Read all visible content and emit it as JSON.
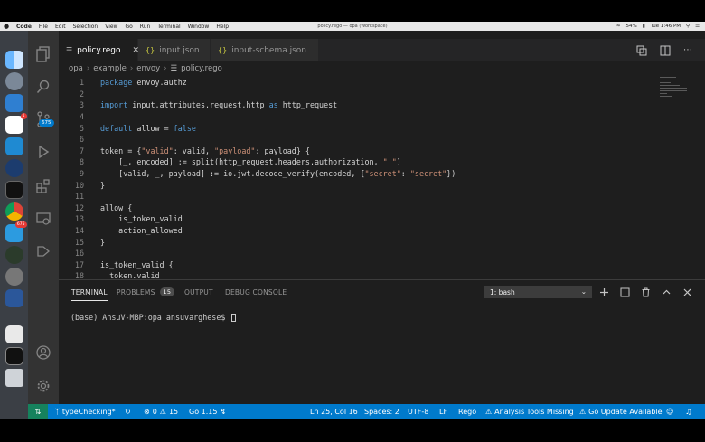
{
  "menubar": {
    "apple": "",
    "items": [
      "Code",
      "File",
      "Edit",
      "Selection",
      "View",
      "Go",
      "Run",
      "Terminal",
      "Window",
      "Help"
    ],
    "window_title": "policy.rego — opa (Workspace)",
    "battery": "54%",
    "clock": "Tue 1:46 PM"
  },
  "dock": {
    "badges": {
      "slack": "1",
      "ps": "675"
    }
  },
  "activity": {
    "scm_badge": "675"
  },
  "tabs": [
    {
      "label": "policy.rego",
      "icon": "policy-file-icon",
      "active": true
    },
    {
      "label": "input.json",
      "icon": "json-braces-icon",
      "active": false
    },
    {
      "label": "input-schema.json",
      "icon": "json-braces-icon",
      "active": false
    }
  ],
  "breadcrumb": [
    "opa",
    "example",
    "envoy",
    "policy.rego"
  ],
  "code_lines": [
    {
      "n": "1",
      "parts": [
        [
          "kw",
          "package"
        ],
        [
          "txt",
          " envoy.authz"
        ]
      ]
    },
    {
      "n": "2",
      "parts": []
    },
    {
      "n": "3",
      "parts": [
        [
          "kw",
          "import"
        ],
        [
          "txt",
          " input.attributes.request.http "
        ],
        [
          "kw",
          "as"
        ],
        [
          "txt",
          " http_request"
        ]
      ]
    },
    {
      "n": "4",
      "parts": []
    },
    {
      "n": "5",
      "parts": [
        [
          "kw",
          "default"
        ],
        [
          "txt",
          " allow = "
        ],
        [
          "kw",
          "false"
        ]
      ]
    },
    {
      "n": "6",
      "parts": []
    },
    {
      "n": "7",
      "parts": [
        [
          "txt",
          "token = {"
        ],
        [
          "str",
          "\"valid\""
        ],
        [
          "txt",
          ": valid, "
        ],
        [
          "str",
          "\"payload\""
        ],
        [
          "txt",
          ": payload} {"
        ]
      ]
    },
    {
      "n": "8",
      "parts": [
        [
          "txt",
          "    [_, encoded] := split(http_request.headers.authorization, "
        ],
        [
          "str",
          "\" \""
        ],
        [
          "txt",
          ")"
        ]
      ]
    },
    {
      "n": "9",
      "parts": [
        [
          "txt",
          "    [valid, _, payload] := io.jwt.decode_verify(encoded, {"
        ],
        [
          "str",
          "\"secret\""
        ],
        [
          "txt",
          ": "
        ],
        [
          "str",
          "\"secret\""
        ],
        [
          "txt",
          "})"
        ]
      ]
    },
    {
      "n": "10",
      "parts": [
        [
          "txt",
          "}"
        ]
      ]
    },
    {
      "n": "11",
      "parts": []
    },
    {
      "n": "12",
      "parts": [
        [
          "txt",
          "allow {"
        ]
      ]
    },
    {
      "n": "13",
      "parts": [
        [
          "txt",
          "    is_token_valid"
        ]
      ]
    },
    {
      "n": "14",
      "parts": [
        [
          "txt",
          "    action_allowed"
        ]
      ]
    },
    {
      "n": "15",
      "parts": [
        [
          "txt",
          "}"
        ]
      ]
    },
    {
      "n": "16",
      "parts": []
    },
    {
      "n": "17",
      "parts": [
        [
          "txt",
          "is_token_valid {"
        ]
      ]
    },
    {
      "n": "18",
      "parts": [
        [
          "txt",
          "  token.valid"
        ]
      ]
    }
  ],
  "panel": {
    "tabs": [
      {
        "label": "TERMINAL",
        "active": true
      },
      {
        "label": "PROBLEMS",
        "badge": "15",
        "active": false
      },
      {
        "label": "OUTPUT",
        "active": false
      },
      {
        "label": "DEBUG CONSOLE",
        "active": false
      }
    ],
    "terminal_select": "1: bash",
    "prompt": "(base) AnsuV-MBP:opa ansuvarghese$ "
  },
  "statusbar": {
    "branch": "typeChecking*",
    "errors": "0",
    "warnings": "15",
    "go_version": "Go 1.15",
    "position": "Ln 25, Col 16",
    "spaces": "Spaces: 2",
    "encoding": "UTF-8",
    "eol": "LF",
    "language": "Rego",
    "analysis": "Analysis Tools Missing",
    "go_update": "Go Update Available"
  },
  "colors": {
    "accent": "#007acc",
    "editor_bg": "#1e1e1e",
    "keyword": "#569cd6",
    "string": "#ce9178"
  }
}
